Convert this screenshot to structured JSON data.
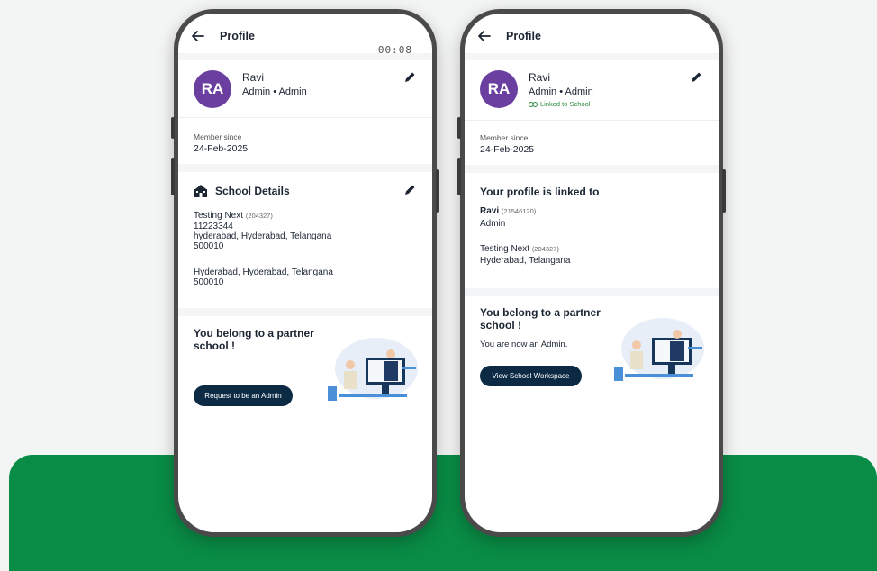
{
  "left_phone": {
    "header": {
      "title": "Profile",
      "timer": "00:08"
    },
    "profile": {
      "initials": "RA",
      "name": "Ravi",
      "role": "Admin • Admin",
      "member_label": "Member since",
      "member_date": "24-Feb-2025"
    },
    "school": {
      "title": "School Details",
      "school_name": "Testing Next",
      "school_code": "(204327)",
      "phone": "11223344",
      "address1": "hyderabad, Hyderabad, Telangana",
      "pin1": "500010",
      "address2": "Hyderabad, Hyderabad, Telangana",
      "pin2": "500010"
    },
    "partner": {
      "title_line1": "You belong to a partner",
      "title_line2": "school !",
      "button": "Request to be an Admin"
    }
  },
  "right_phone": {
    "header": {
      "title": "Profile"
    },
    "profile": {
      "initials": "RA",
      "name": "Ravi",
      "role": "Admin • Admin",
      "linked": "Linked to School",
      "member_label": "Member since",
      "member_date": "24-Feb-2025"
    },
    "linked_section": {
      "title": "Your profile is linked to",
      "person_name": "Ravi",
      "person_code": "(21546120)",
      "person_role": "Admin",
      "school_name": "Testing Next",
      "school_code": "(204327)",
      "school_location": "Hyderabad, Telangana"
    },
    "partner": {
      "title_line1": "You belong to a partner",
      "title_line2": "school !",
      "subtitle": "You are now an Admin.",
      "button": "View School Workspace"
    }
  },
  "colors": {
    "avatar": "#6b3fa0",
    "button": "#0d2a45",
    "green_band": "#098c45",
    "linked_text": "#2b8a3e"
  },
  "icons": [
    "back-arrow-icon",
    "pencil-icon",
    "school-icon",
    "link-icon"
  ]
}
